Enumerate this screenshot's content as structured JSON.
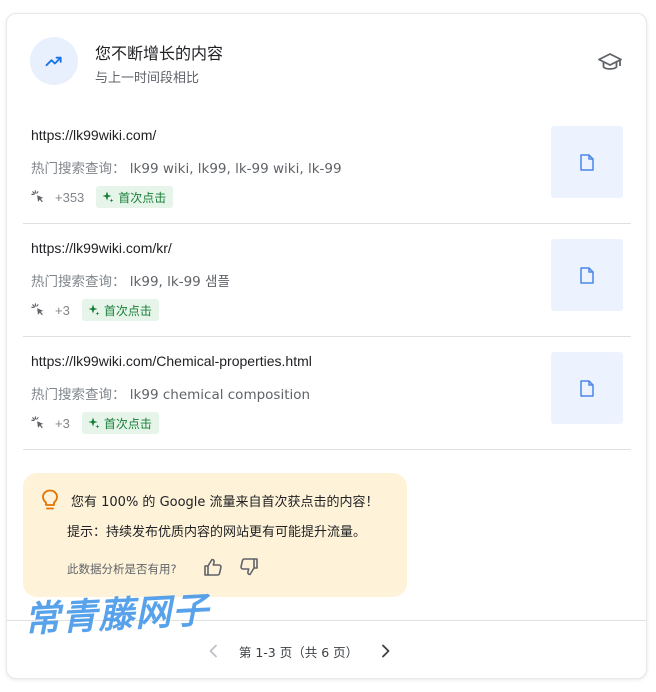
{
  "header": {
    "title": "您不断增长的内容",
    "subtitle": "与上一时间段相比",
    "icon": "trending-up-icon",
    "action_icon": "school-cap-icon"
  },
  "rows": [
    {
      "url": "https://lk99wiki.com/",
      "query_label": "热门搜索查询：",
      "query": "lk99 wiki, lk99, lk-99 wiki, lk-99",
      "delta": "+353",
      "badge": "首次点击"
    },
    {
      "url": "https://lk99wiki.com/kr/",
      "query_label": "热门搜索查询：",
      "query": "lk99, lk-99 샘플",
      "delta": "+3",
      "badge": "首次点击"
    },
    {
      "url": "https://lk99wiki.com/Chemical-properties.html",
      "query_label": "热门搜索查询：",
      "query": "lk99 chemical composition",
      "delta": "+3",
      "badge": "首次点击"
    }
  ],
  "tip": {
    "title": "您有 100% 的 Google 流量来自首次获点击的内容！",
    "body": "提示：持续发布优质内容的网站更有可能提升流量。",
    "feedback_question": "此数据分析是否有用?"
  },
  "pagination": {
    "text": "第 1-3 页（共 6 页）"
  },
  "watermark": "常青藤网子",
  "colors": {
    "accent_blue": "#1a73e8",
    "badge_green": "#188038",
    "badge_bg": "#e6f4ea",
    "tip_bg": "#fef3d9",
    "bulb_orange": "#e37400"
  }
}
